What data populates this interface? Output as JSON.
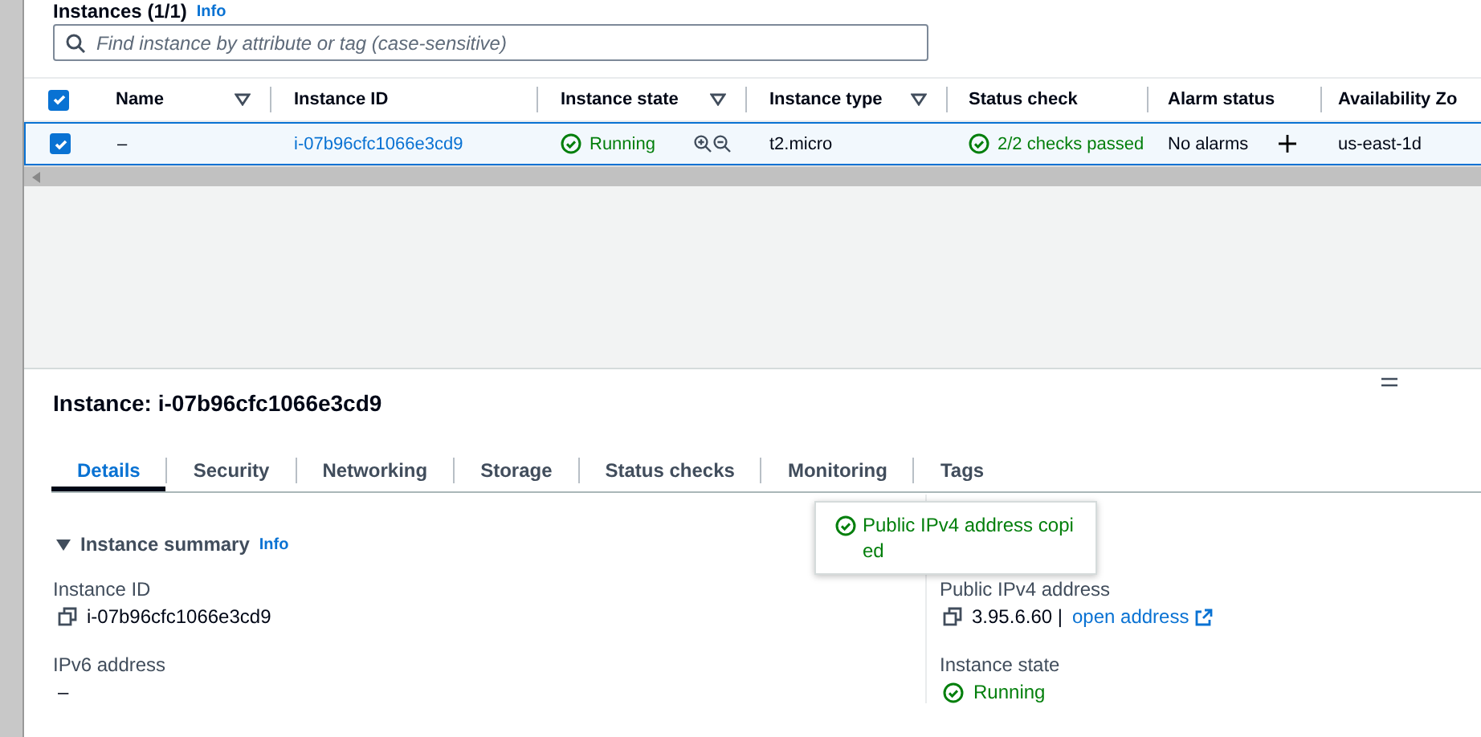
{
  "header": {
    "title": "Instances (1/1)",
    "info": "Info"
  },
  "search": {
    "placeholder": "Find instance by attribute or tag (case-sensitive)"
  },
  "table": {
    "header_checked": true,
    "columns": [
      {
        "label": "Name",
        "filter": true
      },
      {
        "label": "Instance ID",
        "filter": false
      },
      {
        "label": "Instance state",
        "filter": true
      },
      {
        "label": "Instance type",
        "filter": true
      },
      {
        "label": "Status check",
        "filter": false
      },
      {
        "label": "Alarm status",
        "filter": false
      },
      {
        "label": "Availability Zo",
        "filter": false
      }
    ],
    "rows": [
      {
        "selected": true,
        "name": "–",
        "instance_id": "i-07b96cfc1066e3cd9",
        "state": "Running",
        "type": "t2.micro",
        "status_check": "2/2 checks passed",
        "alarm_status": "No alarms",
        "zone": "us-east-1d"
      }
    ]
  },
  "details": {
    "title": "Instance: i-07b96cfc1066e3cd9",
    "tabs": [
      {
        "label": "Details",
        "selected": true
      },
      {
        "label": "Security",
        "selected": false
      },
      {
        "label": "Networking",
        "selected": false
      },
      {
        "label": "Storage",
        "selected": false
      },
      {
        "label": "Status checks",
        "selected": false
      },
      {
        "label": "Monitoring",
        "selected": false
      },
      {
        "label": "Tags",
        "selected": false
      }
    ],
    "summary": {
      "title": "Instance summary",
      "info": "Info",
      "expanded": true
    },
    "left": [
      {
        "label": "Instance ID",
        "value": "i-07b96cfc1066e3cd9",
        "kind": "copy"
      },
      {
        "label": "IPv6 address",
        "value": "–",
        "kind": "plain"
      }
    ],
    "right": [
      {
        "label": "Public IPv4 address",
        "value": "3.95.6.60 |",
        "link": "open address",
        "kind": "copy"
      },
      {
        "label": "Instance state",
        "value": "Running",
        "kind": "status"
      }
    ],
    "toast": "Public IPv4 address copied"
  }
}
